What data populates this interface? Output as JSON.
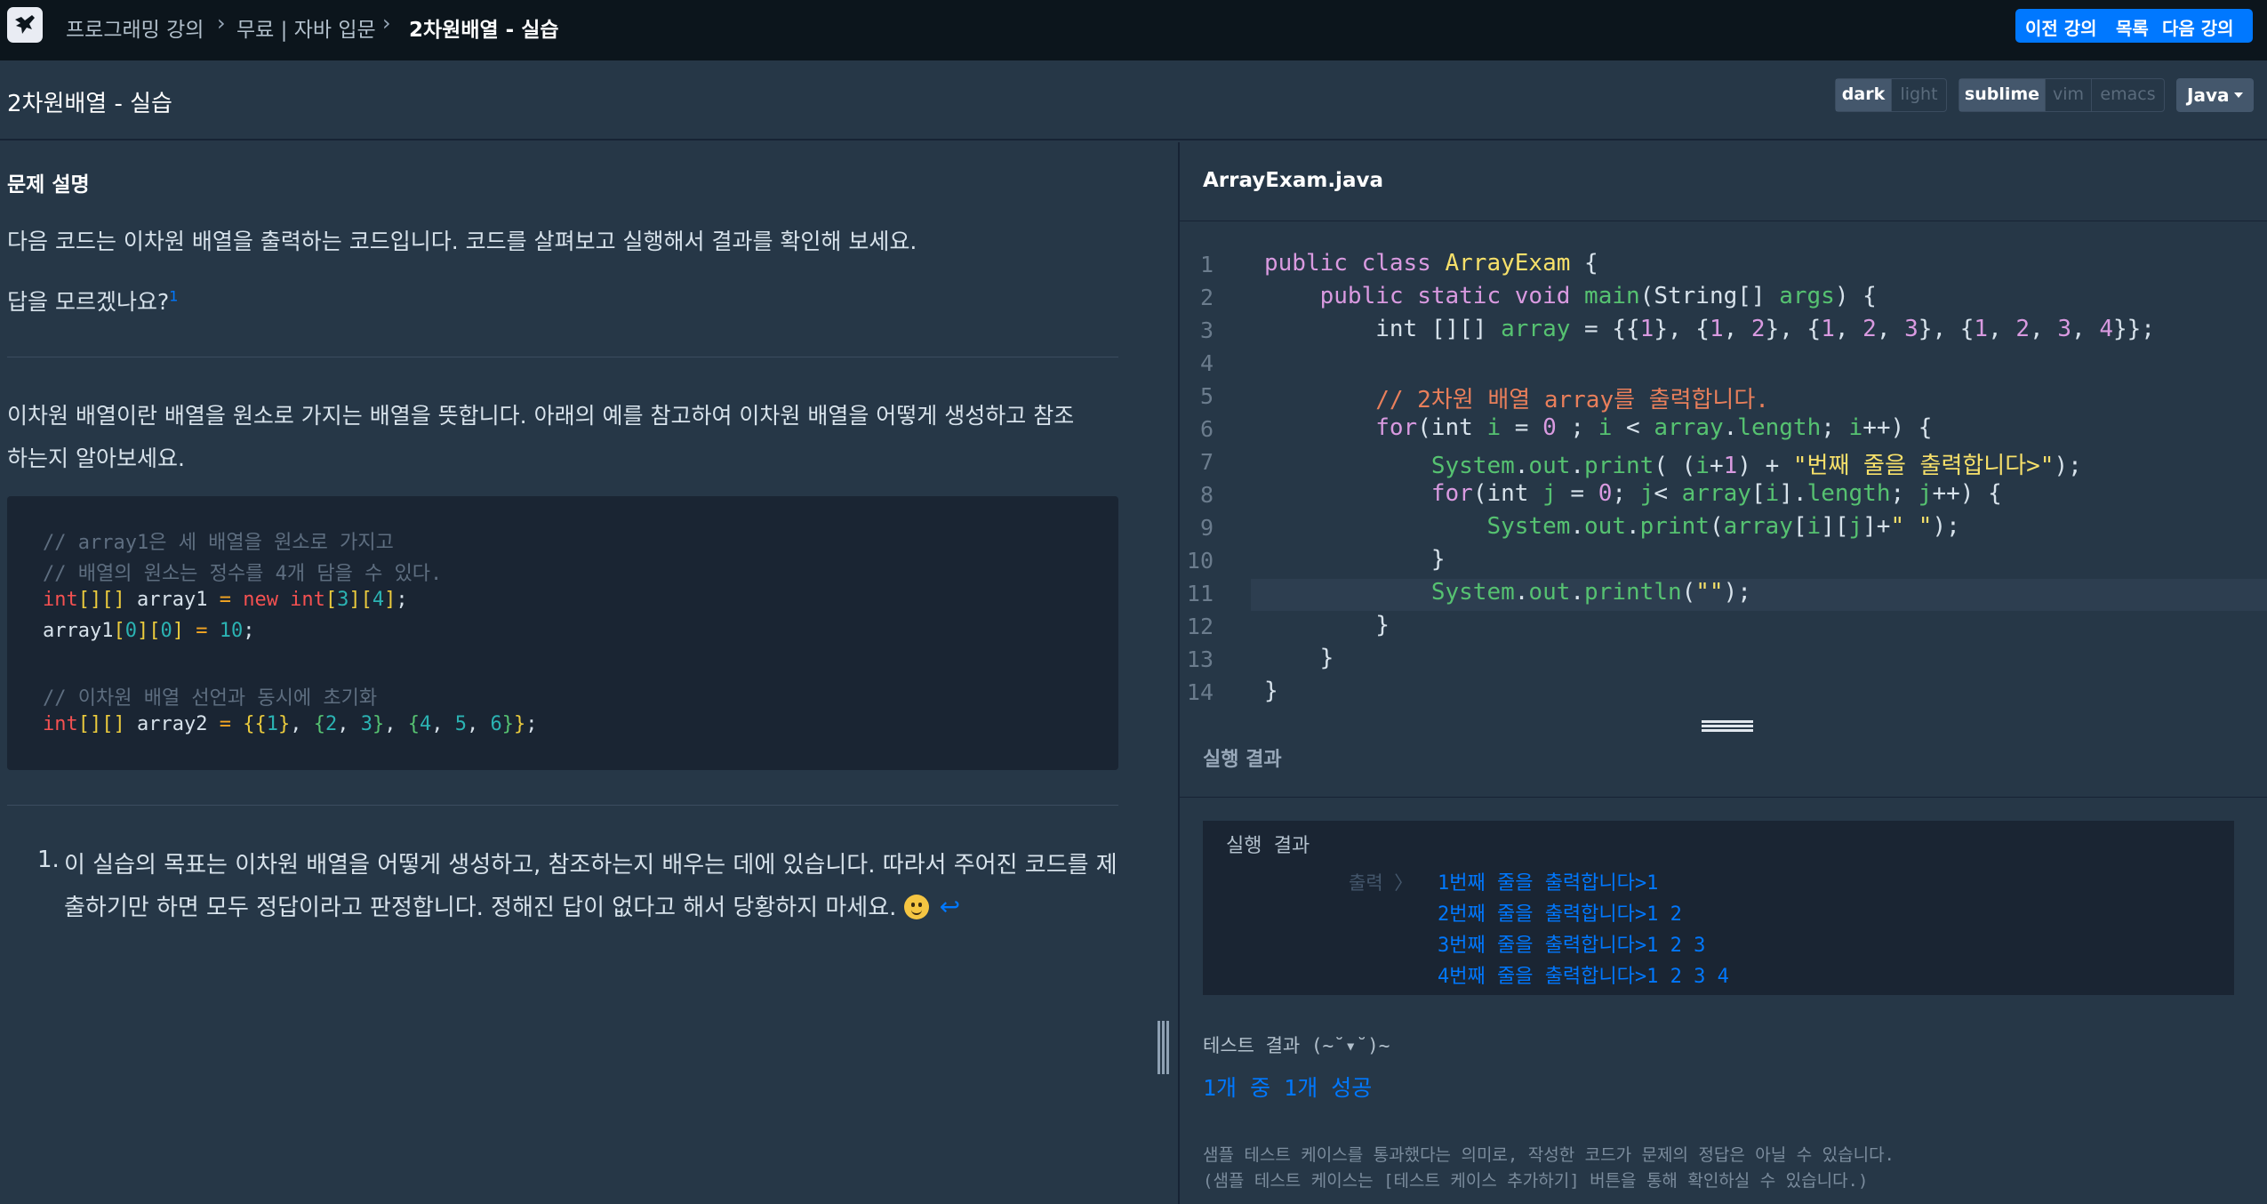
{
  "nav": {
    "breadcrumb": [
      "프로그래밍 강의",
      "무료 | 자바 입문",
      "2차원배열 - 실습"
    ],
    "prev_label": "이전 강의",
    "list_label": "목록",
    "next_label": "다음 강의"
  },
  "header": {
    "title": "2차원배열 - 실습",
    "theme_options": [
      "dark",
      "light"
    ],
    "theme_selected": "dark",
    "keymap_options": [
      "sublime",
      "vim",
      "emacs"
    ],
    "keymap_selected": "sublime",
    "language": "Java"
  },
  "problem": {
    "section_title": "문제 설명",
    "intro": "다음 코드는 이차원 배열을 출력하는 코드입니다. 코드를 살펴보고 실행해서 결과를 확인해 보세요.",
    "hint": "답을 모르겠나요?",
    "hint_ref": "1",
    "desc_line1": "이차원 배열이란 배열을 원소로 가지는 배열을 뜻합니다. 아래의 예를 참고하여 이차원 배열을 어떻게 생성하고 참조",
    "desc_line2": "하는지 알아보세요.",
    "example_code": [
      "// array1은 세 배열을 원소로 가지고",
      "// 배열의 원소는 정수를 4개 담을 수 있다.",
      "int[][] array1 = new int[3][4];",
      "array1[0][0] = 10;",
      "",
      "// 이차원 배열 선언과 동시에 초기화",
      "int[][] array2 = {{1}, {2, 3}, {4, 5, 6}};"
    ],
    "note_number": "1.",
    "note_line1": "이 실습의 목표는 이차원 배열을 어떻게 생성하고, 참조하는지 배우는 데에 있습니다. 따라서 주어진 코드를 제",
    "note_line2": "출하기만 하면 모두 정답이라고 판정합니다. 정해진 답이 없다고 해서 당황하지 마세요."
  },
  "editor": {
    "filename": "ArrayExam.java",
    "line_numbers": [
      "1",
      "2",
      "3",
      "4",
      "5",
      "6",
      "7",
      "8",
      "9",
      "10",
      "11",
      "12",
      "13",
      "14"
    ],
    "lines": [
      "public class ArrayExam {",
      "    public static void main(String[] args) {",
      "        int [][] array = {{1}, {1, 2}, {1, 2, 3}, {1, 2, 3, 4}};",
      "",
      "        // 2차원 배열 array를 출력합니다.",
      "        for(int i = 0 ; i < array.length; i++) {",
      "            System.out.print( (i+1) + \"번째 줄을 출력합니다>\");",
      "            for(int j = 0; j< array[i].length; j++) {",
      "                System.out.print(array[i][j]+\" \");",
      "            }",
      "            System.out.println(\"\");",
      "        }",
      "    }",
      "}"
    ]
  },
  "run": {
    "section_title": "실행 결과",
    "console_title": "실행 결과",
    "output_label": "출력 〉",
    "output_lines": [
      "1번째 줄을 출력합니다>1",
      "2번째 줄을 출력합니다>1 2",
      "3번째 줄을 출력합니다>1 2 3",
      "4번째 줄을 출력합니다>1 2 3 4"
    ],
    "test_title": "테스트 결과 (~˘▾˘)~",
    "test_result": "1개 중 1개 성공",
    "note_line1": "샘플 테스트 케이스를 통과했다는 의미로, 작성한 코드가 문제의 정답은 아닐 수 있습니다.",
    "note_line2": "(샘플 테스트 케이스는 [테스트 케이스 추가하기] 버튼을 통해 확인하실 수 있습니다.)"
  },
  "colors": {
    "accent": "#0078ff",
    "background": "#263747",
    "topbar": "#0c151c"
  }
}
